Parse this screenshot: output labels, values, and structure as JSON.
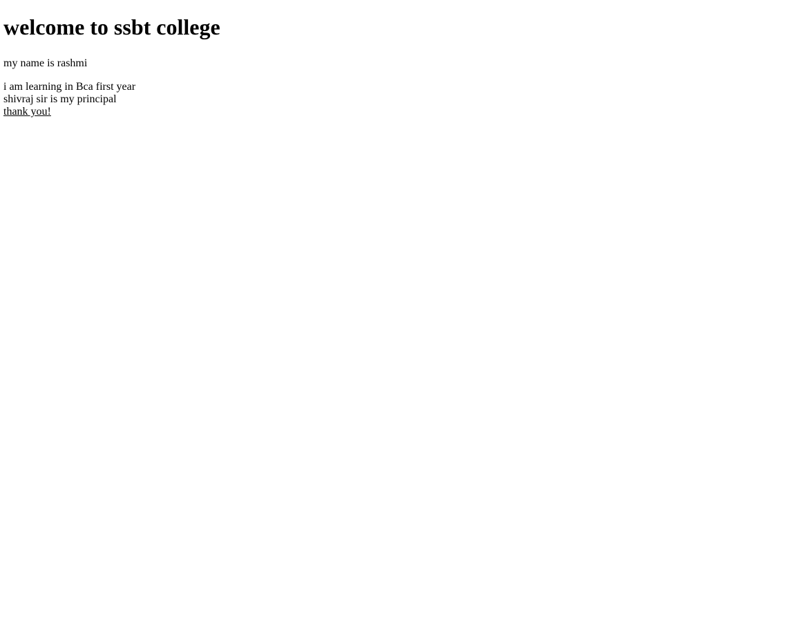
{
  "page": {
    "heading": "welcome to ssbt college",
    "name_text": "my name is rashmi",
    "learning_text": "i am learning in Bca first year",
    "principal_text": "shivraj sir is my principal",
    "thanks_text": "thank you!"
  }
}
